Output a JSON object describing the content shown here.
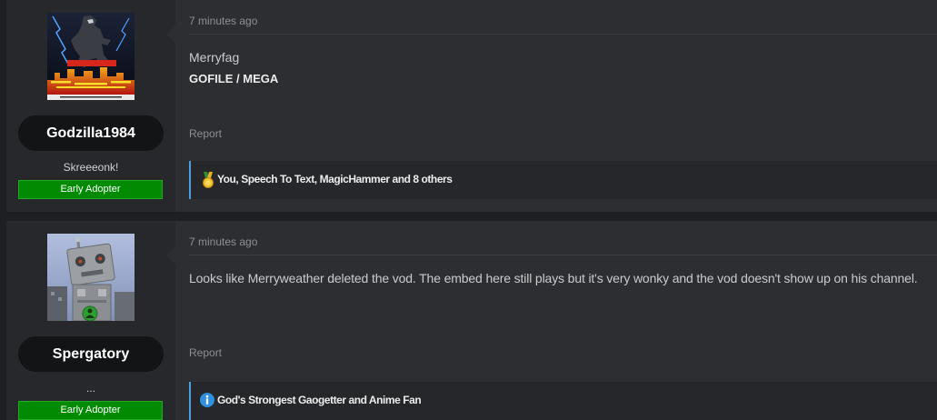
{
  "colors": {
    "page_bg": "#1d1f22",
    "user_column_bg": "#26282b",
    "content_bg": "#2c2e31",
    "username_pill_bg": "#131416",
    "early_adopter_green": "#028a02",
    "reaction_accent_blue": "#4a9fdc"
  },
  "posts": [
    {
      "author": {
        "avatar_icon": "godzilla-poster-avatar",
        "username": "Godzilla1984",
        "user_title": "Skreeeonk!",
        "banner": "Early Adopter"
      },
      "timestamp": "7 minutes ago",
      "body": {
        "text": "Merryfag",
        "links": [
          {
            "label": "GOFILE"
          },
          {
            "label": "MEGA"
          }
        ],
        "link_separator": " / "
      },
      "report_label": "Report",
      "reactions": {
        "icon": "gold-medal-icon",
        "text": "You, Speech To Text, MagicHammer and 8 others"
      }
    },
    {
      "author": {
        "avatar_icon": "robot-avatar",
        "username": "Spergatory",
        "user_title": "...",
        "banner": "Early Adopter"
      },
      "timestamp": "7 minutes ago",
      "body": {
        "text": "Looks like Merryweather deleted the vod. The embed here still plays but it's very wonky and the vod doesn't show up on his channel."
      },
      "report_label": "Report",
      "signature": {
        "icon": "info-icon",
        "text": "God's Strongest Gaogetter and Anime Fan"
      }
    }
  ]
}
